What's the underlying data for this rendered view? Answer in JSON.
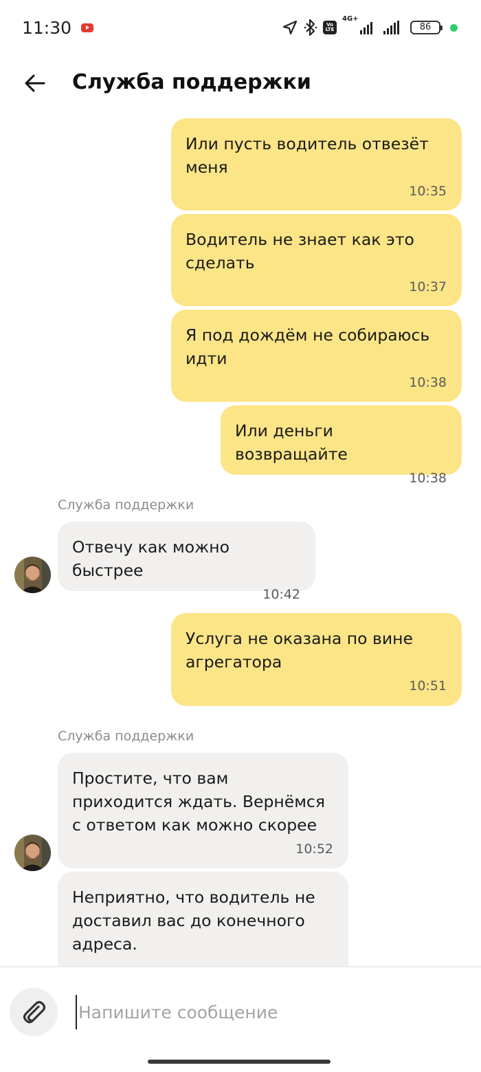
{
  "status_bar": {
    "time": "11:30",
    "network_label": "4G+",
    "battery": "86",
    "icons": [
      "youtube-notification-icon",
      "location-icon",
      "bluetooth-icon",
      "volte-icon",
      "signal-icon",
      "battery-icon"
    ]
  },
  "header": {
    "title": "Служба поддержки",
    "back_icon": "arrow-left-icon"
  },
  "messages": [
    {
      "direction": "out",
      "text": "Или пусть водитель отвезёт меня",
      "time": "10:35"
    },
    {
      "direction": "out",
      "text": "Водитель не знает как это сделать",
      "time": "10:37"
    },
    {
      "direction": "out",
      "text": "Я под дождём не собираюсь идти",
      "time": "10:38"
    },
    {
      "direction": "out",
      "text": "Или деньги возвращайте",
      "time": "10:38"
    },
    {
      "direction": "in",
      "sender": "Служба поддержки",
      "text": "Отвечу как можно быстрее",
      "time": "10:42"
    },
    {
      "direction": "out",
      "text": "Услуга не оказана по вине агрегатора",
      "time": "10:51"
    },
    {
      "direction": "in",
      "sender": "Служба поддержки",
      "text": "Простите, что вам приходится ждать. Вернёмся с ответом как можно скорее",
      "time": "10:52"
    },
    {
      "direction": "in",
      "text": "Неприятно, что водитель не доставил вас до конечного адреса.",
      "time": ""
    }
  ],
  "composer": {
    "placeholder": "Напишите сообщение",
    "attach_icon": "paperclip-icon"
  },
  "colors": {
    "outgoing_bubble": "#fce587",
    "incoming_bubble": "#f1f0ee",
    "status_dot": "#2ecc71"
  }
}
